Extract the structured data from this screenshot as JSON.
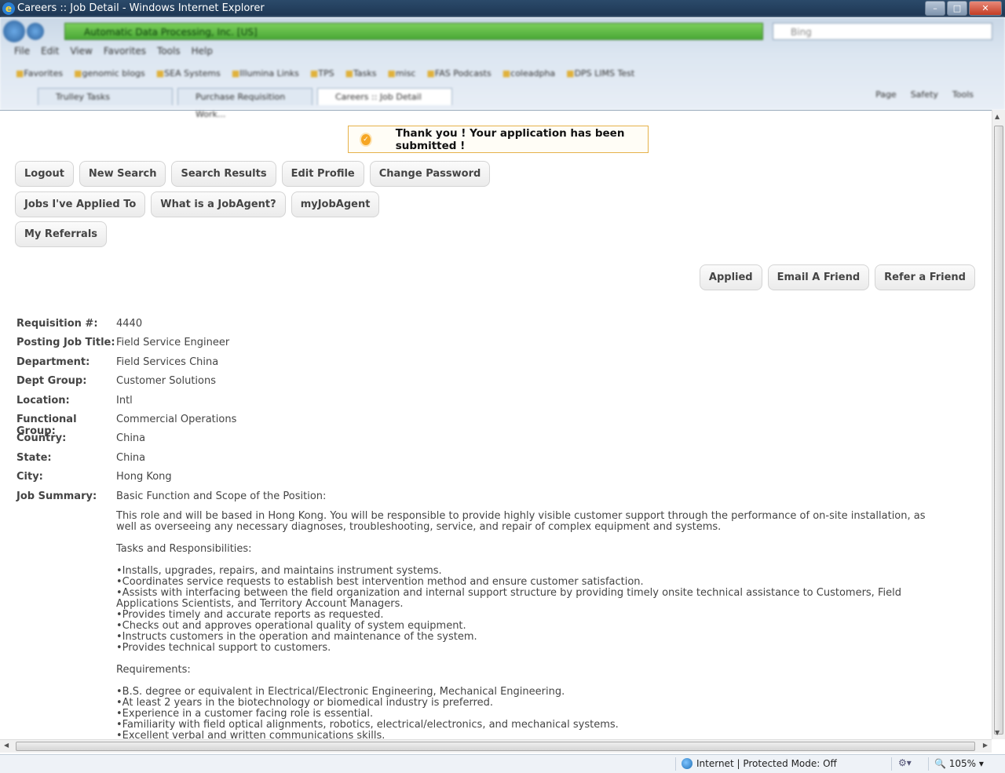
{
  "window": {
    "title": "Careers :: Job Detail - Windows Internet Explorer",
    "ie_icon": "ie-logo-icon"
  },
  "browser": {
    "address_site": "Automatic Data Processing, Inc. [US]",
    "search_placeholder": "Bing",
    "menu": [
      "File",
      "Edit",
      "View",
      "Favorites",
      "Tools",
      "Help"
    ],
    "favorites": [
      "Favorites",
      "genomic blogs",
      "SEA Systems",
      "Illumina Links",
      "TPS",
      "Tasks",
      "misc",
      "FAS Podcasts",
      "coleadpha",
      "DPS LIMS Test"
    ],
    "tabs": [
      "Trulley Tasks",
      "Purchase Requisition Work...",
      "Careers :: Job Detail"
    ],
    "commands": [
      "Page",
      "Safety",
      "Tools"
    ]
  },
  "banner": {
    "message": "Thank you ! Your application has been submitted !",
    "icon": "check-badge-icon"
  },
  "nav_buttons": {
    "row1": [
      "Logout",
      "New Search",
      "Search Results",
      "Edit Profile",
      "Change Password"
    ],
    "row2": [
      "Jobs I've Applied To",
      "What is a JobAgent?",
      "myJobAgent"
    ],
    "row3": [
      "My Referrals"
    ]
  },
  "actions": [
    "Applied",
    "Email A Friend",
    "Refer a Friend"
  ],
  "details": [
    {
      "label": "Requisition #:",
      "value": "4440"
    },
    {
      "label": "Posting Job Title:",
      "value": "Field Service Engineer"
    },
    {
      "label": "Department:",
      "value": "Field Services China"
    },
    {
      "label": "Dept Group:",
      "value": "Customer Solutions"
    },
    {
      "label": "Location:",
      "value": "Intl"
    },
    {
      "label": "Functional Group:",
      "value": "Commercial Operations"
    },
    {
      "label": "Country:",
      "value": "China"
    },
    {
      "label": "State:",
      "value": "China"
    },
    {
      "label": "City:",
      "value": "Hong Kong"
    },
    {
      "label": "Job Summary:",
      "value": "Basic Function and Scope of the Position:"
    }
  ],
  "summary": {
    "intro": "This role and will be based in Hong Kong. You will be responsible to provide highly visible customer support through the performance of on-site installation, as well as overseeing any necessary diagnoses, troubleshooting, service, and repair of complex equipment and systems.",
    "tasks_heading": "Tasks and Responsibilities:",
    "tasks": [
      "Installs, upgrades, repairs, and maintains instrument systems.",
      "Coordinates service requests to establish best intervention method and ensure customer satisfaction.",
      "Assists with interfacing between the field organization and internal support structure by providing timely onsite technical assistance to Customers, Field Applications Scientists, and Territory Account Managers.",
      "Provides timely and accurate reports as requested.",
      "Checks out and approves operational quality of system equipment.",
      "Instructs customers in the operation and maintenance of the system.",
      "Provides technical support to customers."
    ],
    "requirements_heading": "Requirements:",
    "requirements": [
      "B.S. degree or equivalent in Electrical/Electronic Engineering, Mechanical Engineering.",
      "At least 2 years in the biotechnology or biomedical industry is preferred.",
      "Experience in a customer facing role is essential.",
      "Familiarity with field optical alignments, robotics, electrical/electronics, and mechanical systems.",
      "Excellent verbal and written communications skills."
    ]
  },
  "status_bar": {
    "zone": "Internet | Protected Mode: Off",
    "zoom": "105%"
  }
}
